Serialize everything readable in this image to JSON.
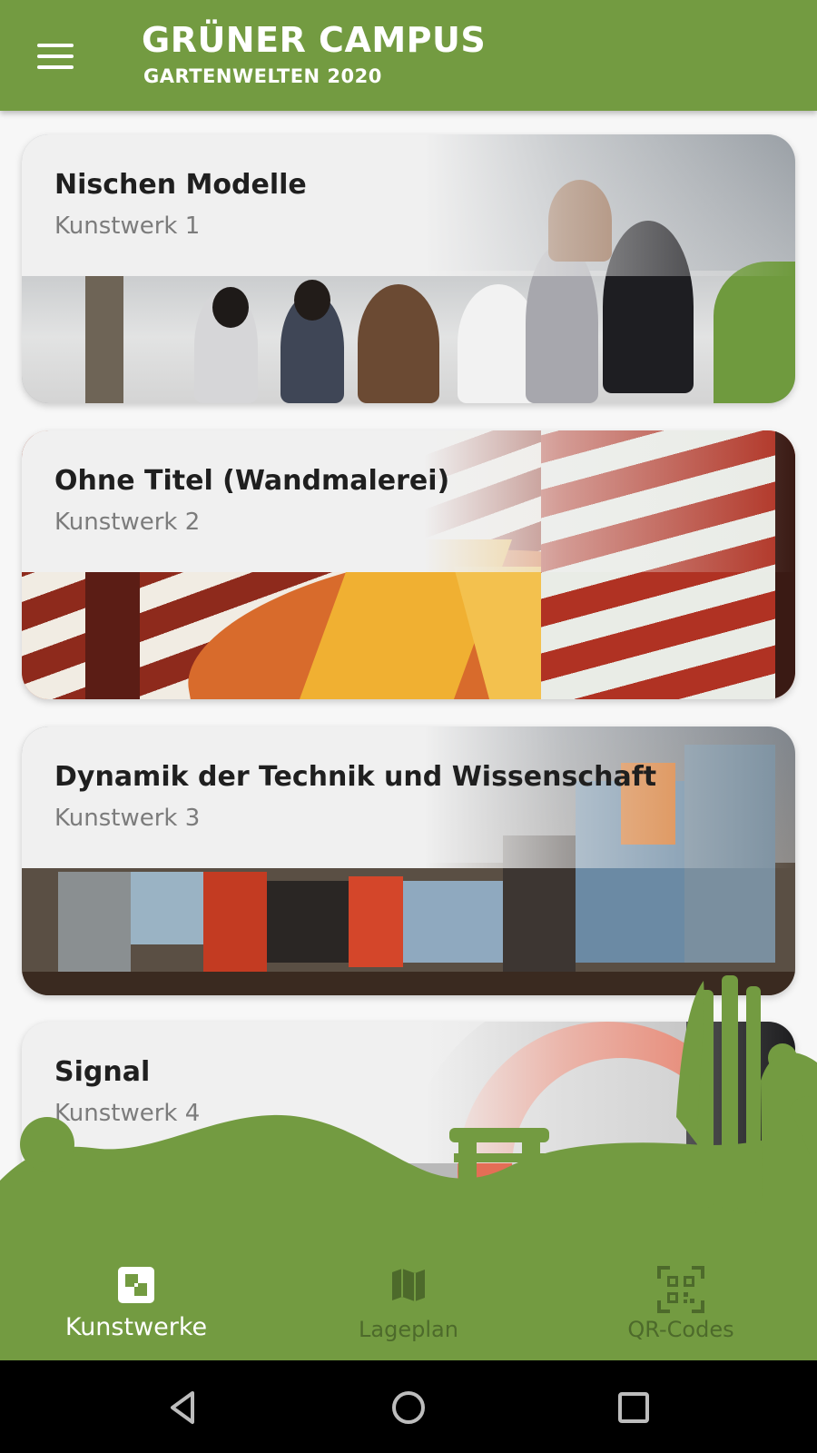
{
  "header": {
    "title": "GRÜNER CAMPUS",
    "subtitle": "GARTENWELTEN 2020",
    "menu_icon": "menu-icon",
    "background": "#739b41"
  },
  "cards": [
    {
      "title": "Nischen Modelle",
      "subtitle": "Kunstwerk 1"
    },
    {
      "title": "Ohne Titel (Wandmalerei)",
      "subtitle": "Kunstwerk 2"
    },
    {
      "title": "Dynamik der Technik und Wissenschaft",
      "subtitle": "Kunstwerk 3"
    },
    {
      "title": "Signal",
      "subtitle": "Kunstwerk 4"
    }
  ],
  "bottom_nav": {
    "items": [
      {
        "label": "Kunstwerke",
        "icon": "artworks-icon",
        "active": true
      },
      {
        "label": "Lageplan",
        "icon": "map-icon",
        "active": false
      },
      {
        "label": "QR-Codes",
        "icon": "qr-code-icon",
        "active": false
      }
    ]
  },
  "system_nav": {
    "back_icon": "back-icon",
    "home_icon": "home-icon",
    "recents_icon": "recents-icon"
  },
  "colors": {
    "brand_green": "#739b41",
    "inactive_nav": "#4d6a2b"
  }
}
